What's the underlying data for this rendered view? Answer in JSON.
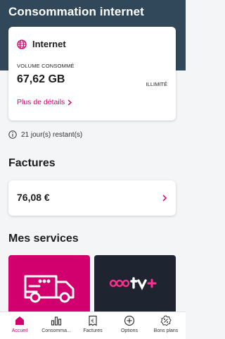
{
  "header": {
    "title": "Consommation internet"
  },
  "internet_card": {
    "title": "Internet",
    "volume_label": "VOLUME CONSOMMÉ",
    "volume_value": "67,62 GB",
    "limit": "ILLIMITÉ",
    "details_link": "Plus de détails"
  },
  "remaining": {
    "text": "21 jour(s) restant(s)"
  },
  "invoices": {
    "title": "Factures",
    "amount": "76,08 €"
  },
  "services": {
    "title": "Mes services"
  },
  "nav": {
    "items": [
      {
        "label": "Accueil",
        "icon": "home-icon",
        "active": true
      },
      {
        "label": "Consomma...",
        "icon": "usage-bars-icon",
        "active": false
      },
      {
        "label": "Factures",
        "icon": "invoice-icon",
        "active": false
      },
      {
        "label": "Options",
        "icon": "plus-circle-icon",
        "active": false
      },
      {
        "label": "Bons plans",
        "icon": "discount-icon",
        "active": false
      }
    ]
  },
  "colors": {
    "accent": "#d2006e",
    "header": "#31485a",
    "tile_dark": "#1e2430"
  }
}
